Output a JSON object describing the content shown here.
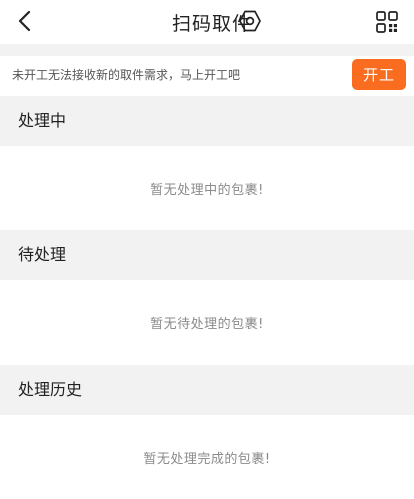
{
  "header": {
    "title": "扫码取件",
    "back_icon": "chevron-left-icon",
    "settings_icon": "hexagon-gear-icon",
    "qr_icon": "qr-code-icon"
  },
  "notice": {
    "text": "未开工无法接收新的取件需求，马上开工吧",
    "start_button": "开工",
    "start_button_color": "#fa6c1f"
  },
  "sections": [
    {
      "title": "处理中",
      "empty_text": "暂无处理中的包裹!"
    },
    {
      "title": "待处理",
      "empty_text": "暂无待处理的包裹!"
    },
    {
      "title": "处理历史",
      "empty_text": "暂无处理完成的包裹!"
    }
  ]
}
